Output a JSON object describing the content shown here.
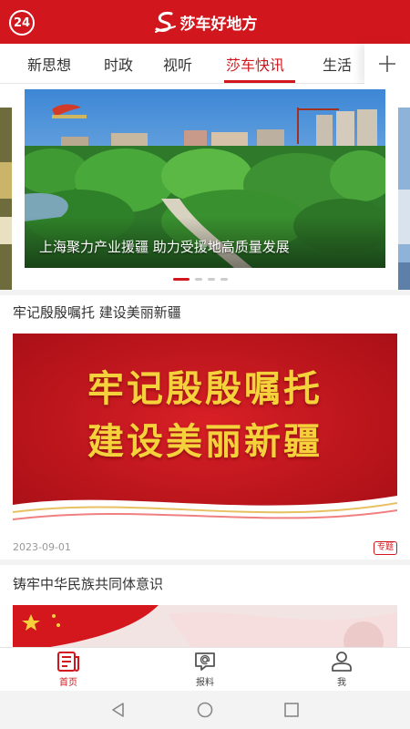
{
  "header": {
    "counter_badge": "24",
    "brand_name": "莎车好地方"
  },
  "tabs": [
    {
      "label": "新思想"
    },
    {
      "label": "时政"
    },
    {
      "label": "视听"
    },
    {
      "label": "莎车快讯",
      "active": true
    },
    {
      "label": "生活"
    }
  ],
  "carousel": {
    "caption": "上海聚力产业援疆 助力受援地高质量发展",
    "slide_count": 4,
    "active_index": 0
  },
  "articles": [
    {
      "title": "牢记殷殷嘱托 建设美丽新疆",
      "banner_line1": "牢记殷殷嘱托",
      "banner_line2": "建设美丽新疆",
      "date": "2023-09-01",
      "badge": "专题"
    },
    {
      "title": "铸牢中华民族共同体意识"
    }
  ],
  "bottom_nav": [
    {
      "label": "首页",
      "icon": "home-news-icon",
      "active": true
    },
    {
      "label": "报料",
      "icon": "report-chat-icon"
    },
    {
      "label": "我",
      "icon": "user-icon"
    }
  ],
  "colors": {
    "accent": "#d1171d",
    "banner_red": "#c4161c",
    "banner_gold": "#f5d23c"
  }
}
